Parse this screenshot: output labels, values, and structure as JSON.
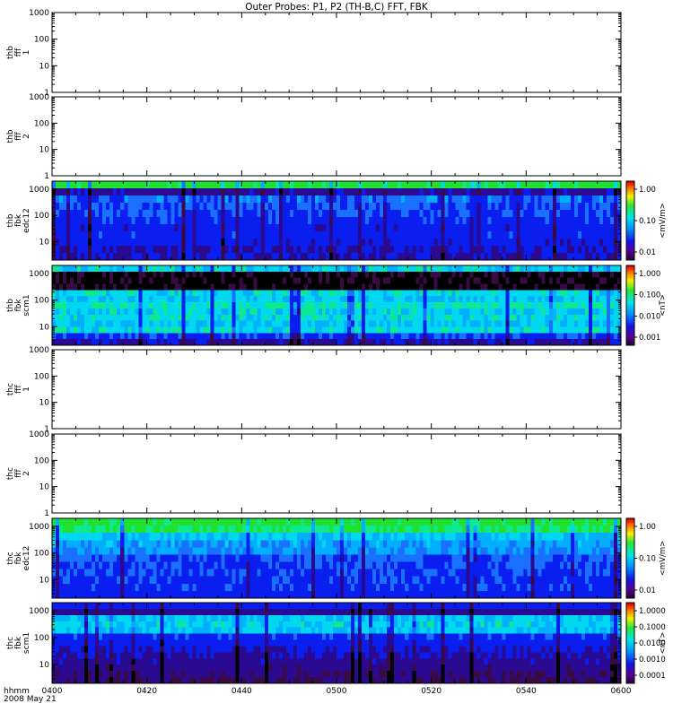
{
  "title": "Outer Probes: P1, P2 (TH-B,C) FFT, FBK",
  "footer": {
    "line1": "hhmm",
    "line2": "2008 May 21"
  },
  "chart_data": {
    "type": "heatmap",
    "x_ticks": [
      "0400",
      "0420",
      "0440",
      "0500",
      "0520",
      "0540",
      "0600"
    ],
    "ylabel_scale": "log",
    "panels": [
      {
        "id": "thb-fff-1",
        "label": [
          "thb",
          "fff",
          "1"
        ],
        "ylim": [
          1,
          1000
        ],
        "y_ticks": [
          "1000",
          "100",
          "10",
          "1"
        ],
        "filled": false
      },
      {
        "id": "thb-fff-2",
        "label": [
          "thb",
          "fff",
          "2"
        ],
        "ylim": [
          1,
          1000
        ],
        "y_ticks": [
          "1000",
          "100",
          "10",
          "1"
        ],
        "filled": false
      },
      {
        "id": "thb-fbk-edc12",
        "label": [
          "thb",
          "fbk",
          "edc12"
        ],
        "ylim": [
          2,
          2000
        ],
        "y_ticks": [
          "1000",
          "100",
          "10"
        ],
        "filled": true,
        "colorbar": {
          "unit": "<mV/m>",
          "ticks": [
            "1.00",
            "0.10",
            "0.01"
          ]
        },
        "bands": [
          1.6,
          0.5,
          0.95,
          0.9,
          0.85,
          0.8,
          0.72,
          0.78,
          0.7,
          0.62,
          0.6
        ]
      },
      {
        "id": "thb-fbk-scm1",
        "label": [
          "thb",
          "fbk",
          "scm1"
        ],
        "ylim": [
          2,
          2000
        ],
        "y_ticks": [
          "1000",
          "100",
          "10"
        ],
        "filled": true,
        "colorbar": {
          "unit": "<nT>",
          "ticks": [
            "1.000",
            "0.100",
            "0.010",
            "0.001"
          ]
        },
        "bands": [
          1.25,
          0.02,
          0.02,
          0.02,
          1.3,
          1.2,
          1.35,
          1.25,
          1.3,
          1.2,
          1.3,
          0.85,
          0.55
        ]
      },
      {
        "id": "thc-fff-1",
        "label": [
          "thc",
          "fff",
          "1"
        ],
        "ylim": [
          1,
          1000
        ],
        "y_ticks": [
          "1000",
          "100",
          "10",
          "1"
        ],
        "filled": false
      },
      {
        "id": "thc-fff-2",
        "label": [
          "thc",
          "fff",
          "2"
        ],
        "ylim": [
          1,
          1000
        ],
        "y_ticks": [
          "1000",
          "100",
          "10",
          "1"
        ],
        "filled": false
      },
      {
        "id": "thc-fbk-edc12",
        "label": [
          "thc",
          "fbk",
          "edc12"
        ],
        "ylim": [
          2,
          2000
        ],
        "y_ticks": [
          "1000",
          "100",
          "10"
        ],
        "filled": true,
        "colorbar": {
          "unit": "<mV/m>",
          "ticks": [
            "1.00",
            "0.10",
            "0.01"
          ]
        },
        "bands": [
          1.6,
          1.5,
          1.2,
          1.1,
          1.05,
          0.9,
          0.88,
          0.85,
          0.82,
          0.8,
          0.75
        ]
      },
      {
        "id": "thc-fbk-scm1",
        "label": [
          "thc",
          "fbk",
          "scm1"
        ],
        "ylim": [
          2,
          2000
        ],
        "y_ticks": [
          "1000",
          "100",
          "10"
        ],
        "filled": true,
        "colorbar": {
          "unit": "<nT>",
          "ticks": [
            "1.0000",
            "0.1000",
            "0.0100",
            "0.0010",
            "0.0001"
          ]
        },
        "bands": [
          0.75,
          0.45,
          1.2,
          1.25,
          1.2,
          0.82,
          0.75,
          0.65,
          0.55,
          0.48,
          0.38,
          0.3,
          0.25
        ]
      }
    ]
  }
}
